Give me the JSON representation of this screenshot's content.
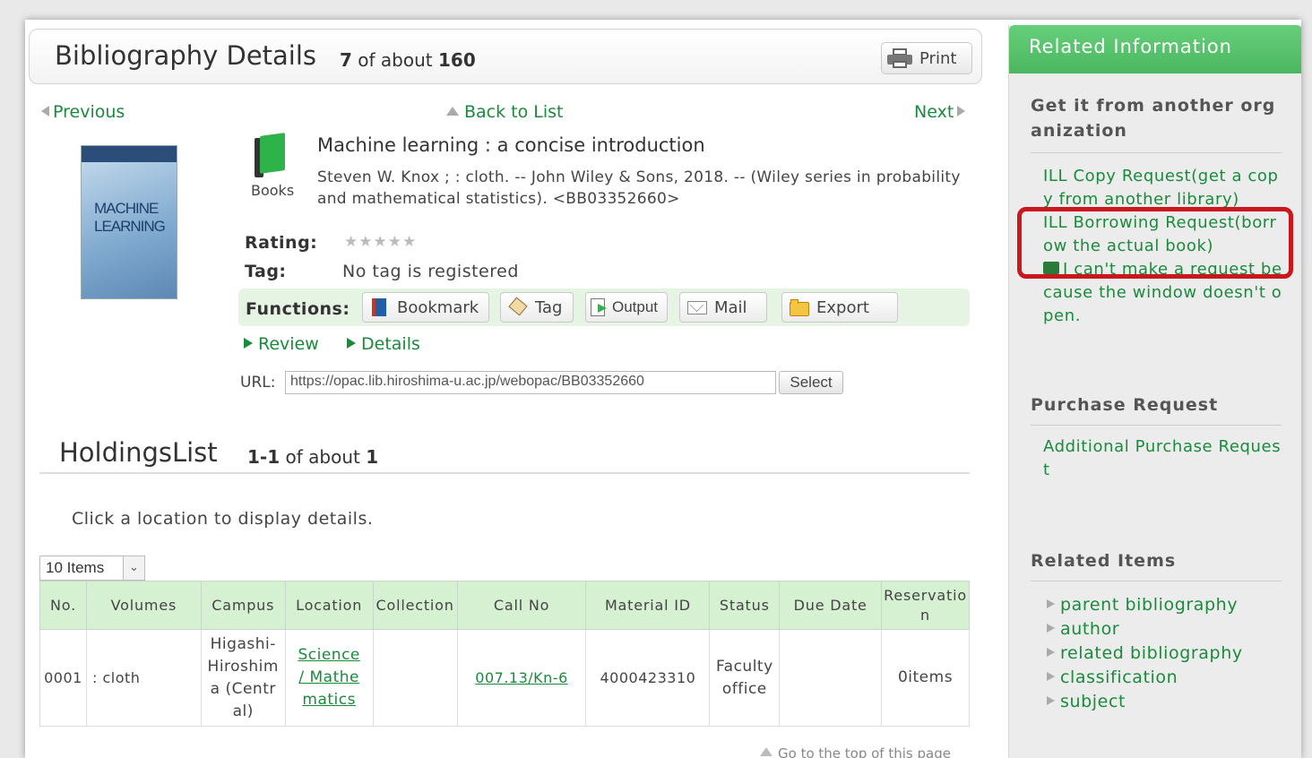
{
  "header": {
    "title": "Bibliography Details",
    "count_num": "7",
    "count_of": "of about",
    "count_total": "160",
    "print_label": "Print"
  },
  "nav": {
    "previous": "Previous",
    "back": "Back to List",
    "next": "Next"
  },
  "book": {
    "cover_text": "MACHINE LEARNING",
    "type_label": "Books",
    "title": "Machine learning : a concise introduction",
    "description": "Steven W. Knox ; : cloth. -- John Wiley & Sons, 2018. -- (Wiley series in probability and mathematical statistics). <BB03352660>",
    "rating_label": "Rating:",
    "rating_stars": "★★★★★",
    "tag_label": "Tag:",
    "tag_value": "No tag is registered"
  },
  "functions": {
    "label": "Functions:",
    "bookmark": "Bookmark",
    "tag": "Tag",
    "output": "Output",
    "mail": "Mail",
    "export": "Export"
  },
  "sublinks": {
    "review": "Review",
    "details": "Details"
  },
  "url": {
    "label": "URL:",
    "value": "https://opac.lib.hiroshima-u.ac.jp/webopac/BB03352660",
    "select": "Select"
  },
  "holdings": {
    "title": "HoldingsList",
    "count_range": "1-1",
    "count_of": "of about",
    "count_total": "1",
    "hint": "Click a location to display details.",
    "pager": "10 Items",
    "columns": [
      "No.",
      "Volumes",
      "Campus",
      "Location",
      "Collection",
      "Call No",
      "Material ID",
      "Status",
      "Due Date",
      "Reservation"
    ],
    "rows": [
      {
        "no": "0001",
        "volumes": ": cloth",
        "campus": "Higashi-Hiroshima (Central)",
        "location": "Science / Mathematics",
        "collection": "",
        "call_no": "007.13/Kn-6",
        "material_id": "4000423310",
        "status": "Faculty office",
        "due_date": "",
        "reservation": "0items"
      }
    ],
    "goto_top": "Go to the top of this page"
  },
  "side": {
    "header": "Related Information",
    "sec1_title": "Get it from another organization",
    "ill_copy": "ILL Copy Request(get a copy from another library)",
    "ill_borrow": "ILL Borrowing Request(borrow the actual book)",
    "ill_warn": "I can't make a request because the window doesn't open.",
    "sec2_title": "Purchase Request",
    "purchase": "Additional Purchase Request",
    "sec3_title": "Related Items",
    "related": [
      "parent bibliography",
      "author",
      "related bibliography",
      "classification",
      "subject"
    ]
  }
}
